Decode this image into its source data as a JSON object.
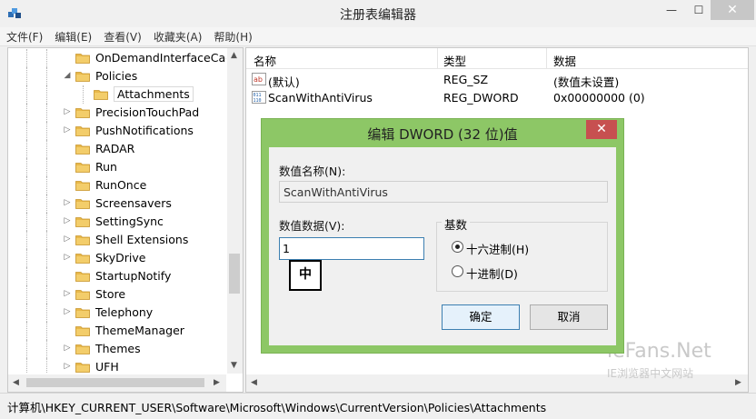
{
  "window": {
    "title": "注册表编辑器",
    "minimize": "—",
    "maximize": "☐",
    "close": "✕"
  },
  "menu": [
    "文件(F)",
    "编辑(E)",
    "查看(V)",
    "收藏夹(A)",
    "帮助(H)"
  ],
  "tree": {
    "items": [
      {
        "label": "OnDemandInterfaceCach",
        "expander": ""
      },
      {
        "label": "Policies",
        "expander": "◢"
      },
      {
        "label": "Attachments",
        "expander": "",
        "selected": true
      },
      {
        "label": "PrecisionTouchPad",
        "expander": "▷"
      },
      {
        "label": "PushNotifications",
        "expander": "▷"
      },
      {
        "label": "RADAR",
        "expander": ""
      },
      {
        "label": "Run",
        "expander": ""
      },
      {
        "label": "RunOnce",
        "expander": ""
      },
      {
        "label": "Screensavers",
        "expander": "▷"
      },
      {
        "label": "SettingSync",
        "expander": "▷"
      },
      {
        "label": "Shell Extensions",
        "expander": "▷"
      },
      {
        "label": "SkyDrive",
        "expander": "▷"
      },
      {
        "label": "StartupNotify",
        "expander": ""
      },
      {
        "label": "Store",
        "expander": "▷"
      },
      {
        "label": "Telephony",
        "expander": "▷"
      },
      {
        "label": "ThemeManager",
        "expander": ""
      },
      {
        "label": "Themes",
        "expander": "▷"
      },
      {
        "label": "UFH",
        "expander": "▷"
      }
    ]
  },
  "list": {
    "headers": {
      "name": "名称",
      "type": "类型",
      "data": "数据"
    },
    "rows": [
      {
        "icon": "string-value-icon",
        "name": "(默认)",
        "type": "REG_SZ",
        "data": "(数值未设置)"
      },
      {
        "icon": "dword-value-icon",
        "name": "ScanWithAntiVirus",
        "type": "REG_DWORD",
        "data": "0x00000000 (0)"
      }
    ]
  },
  "status": {
    "path": "计算机\\HKEY_CURRENT_USER\\Software\\Microsoft\\Windows\\CurrentVersion\\Policies\\Attachments"
  },
  "dialog": {
    "title": "编辑 DWORD (32 位)值",
    "close": "✕",
    "name_label": "数值名称(N):",
    "name_value": "ScanWithAntiVirus",
    "data_label": "数值数据(V):",
    "data_value": "1",
    "ime_indicator": "中",
    "base_label": "基数",
    "radio_hex": "十六进制(H)",
    "radio_dec": "十进制(D)",
    "hex_selected": true,
    "ok": "确定",
    "cancel": "取消"
  },
  "watermark": {
    "line1": "ieFans.Net",
    "line2": "IE浏览器中文网站"
  },
  "colors": {
    "dialog_frame": "#8dc766",
    "close_red": "#c75050",
    "folder_yellow": "#e8b84a"
  }
}
